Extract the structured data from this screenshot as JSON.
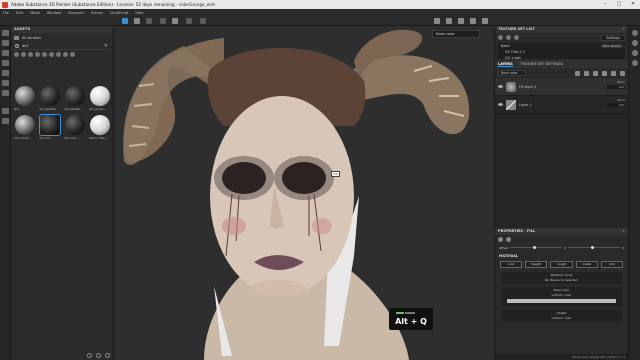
{
  "window": {
    "title": "Adobe Substance 3D Painter (Substance Edition) - License: 52 days remaining - colorGrunge_end",
    "controls": [
      "–",
      "□",
      "✕"
    ]
  },
  "menu": [
    "File",
    "Edit",
    "Mode",
    "Window",
    "Viewport",
    "Python",
    "JavaScript",
    "Help"
  ],
  "assets": {
    "panel_title": "ASSETS",
    "library": "All libraries",
    "search_value": "dirt",
    "items": [
      {
        "label": "Dirt",
        "style": "normal"
      },
      {
        "label": "dirt_splatter",
        "style": "dark"
      },
      {
        "label": "dirt_splatte...",
        "style": "dark"
      },
      {
        "label": "dirt_scratc...",
        "style": "white"
      },
      {
        "label": "dirt_hands...",
        "style": "normal"
      },
      {
        "label": "dirt_dot...",
        "style": "dark"
      },
      {
        "label": "dirt_rust...",
        "style": "dark"
      },
      {
        "label": "Fabric Than...",
        "style": "white"
      }
    ]
  },
  "viewport": {
    "view_mode": "Base color",
    "cursor_label": "CS",
    "shortcut_overlay": "Alt + Q"
  },
  "texture_set_list": {
    "title": "TEXTURE SET LIST",
    "settings_label": "Settings",
    "item_name": "Basic",
    "shader": "Main shader",
    "sub_items": [
      "UV Tiles 0 1",
      "UV: c:bas"
    ]
  },
  "layers": {
    "tabs": [
      "LAYERS",
      "TEXTURE SET SETTINGS"
    ],
    "channel_dropdown": "Base color",
    "list": [
      {
        "name": "Fill layer 1",
        "blend": "Norm",
        "opacity": "100",
        "kind": "fill",
        "selected": true
      },
      {
        "name": "Layer 1",
        "blend": "Norm",
        "opacity": "100",
        "kind": "paint",
        "selected": false
      }
    ]
  },
  "properties": {
    "title": "PROPERTIES - FILL",
    "slider_label": "Offset",
    "slider_value_a": "0",
    "slider_value_b": "0",
    "material_label": "MATERIAL",
    "channels": [
      "color",
      "height",
      "rough",
      "metal",
      "nrm"
    ],
    "material_mode_label": "Material mode",
    "material_mode_value": "No Resource Selected",
    "base_color_label": "Base color",
    "base_color_value": "uniform color",
    "height_label": "Height",
    "height_value": "uniform color"
  },
  "status_bar": "Clauze Gen Usages   3DA  |  Version: 7.4"
}
